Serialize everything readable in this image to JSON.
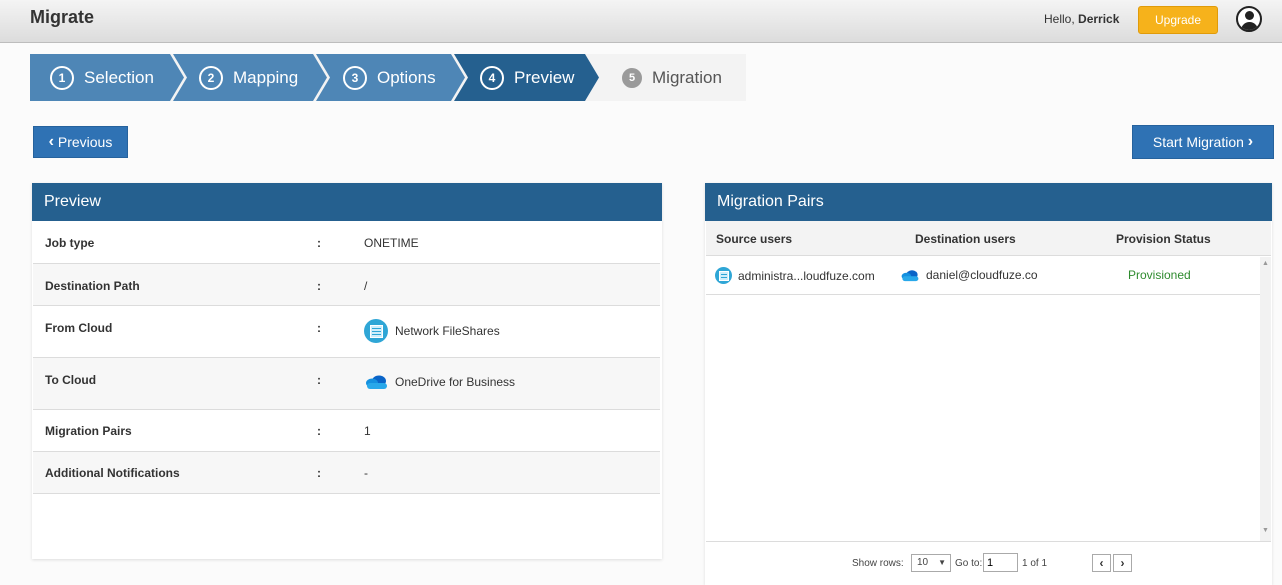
{
  "header": {
    "title": "Migrate",
    "greeting": "Hello,",
    "user": "Derrick",
    "upgrade_label": "Upgrade"
  },
  "steps": [
    {
      "num": "1",
      "label": "Selection",
      "state": "done",
      "color": "#4e86b6"
    },
    {
      "num": "2",
      "label": "Mapping",
      "state": "done",
      "color": "#4e86b6"
    },
    {
      "num": "3",
      "label": "Options",
      "state": "done",
      "color": "#4e86b6"
    },
    {
      "num": "4",
      "label": "Preview",
      "state": "active",
      "color": "#25608f"
    },
    {
      "num": "5",
      "label": "Migration",
      "state": "future",
      "color": "#f3f3f3"
    }
  ],
  "actions": {
    "previous_label": "Previous",
    "start_label": "Start Migration"
  },
  "preview": {
    "title": "Preview",
    "rows": [
      {
        "label": "Job type",
        "sep": ":",
        "value": "ONETIME"
      },
      {
        "label": "Destination Path",
        "sep": ":",
        "value": "/"
      },
      {
        "label": "From Cloud",
        "sep": ":",
        "value": "Network FileShares",
        "icon": "network-fileshares-icon"
      },
      {
        "label": "To Cloud",
        "sep": ":",
        "value": "OneDrive for Business",
        "icon": "onedrive-icon"
      },
      {
        "label": "Migration Pairs",
        "sep": ":",
        "value": "1"
      },
      {
        "label": "Additional Notifications",
        "sep": ":",
        "value": "-"
      }
    ]
  },
  "pairs": {
    "title": "Migration Pairs",
    "columns": [
      "Source users",
      "Destination users",
      "Provision Status"
    ],
    "rows": [
      {
        "source": "administra...loudfuze.com",
        "destination": "daniel@cloudfuze.co",
        "status": "Provisioned"
      }
    ],
    "status_color": "#2e8b2e",
    "footer": {
      "show_rows_label": "Show rows:",
      "rows_value": "10",
      "go_to_label": "Go to:",
      "go_to_value": "1",
      "page_info": "1 of 1"
    }
  }
}
